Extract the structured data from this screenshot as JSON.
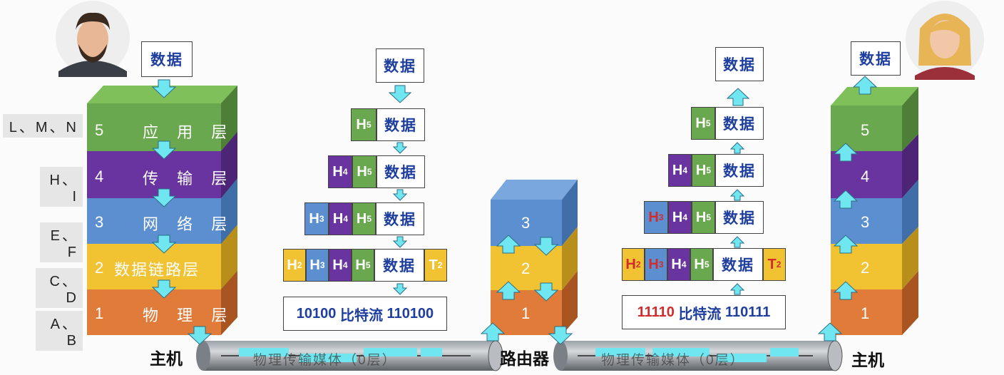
{
  "left_stack": {
    "layers": [
      {
        "num": "5",
        "name": "应 用 层",
        "side": "L、M、N"
      },
      {
        "num": "4",
        "name": "传 输 层",
        "side": "H、I"
      },
      {
        "num": "3",
        "name": "网 络 层",
        "side": "E、F"
      },
      {
        "num": "2",
        "name": "数据链路层",
        "side": "C、D"
      },
      {
        "num": "1",
        "name": "物 理 层",
        "side": "A、B"
      }
    ],
    "top_box": "数据"
  },
  "encap": {
    "data_label": "数据",
    "h5": "H",
    "h4": "H",
    "h3": "H",
    "h2": "H",
    "t2": "T",
    "s5": "5",
    "s4": "4",
    "s3": "3",
    "s2": "2",
    "bits_left": "10100",
    "bits_mid": "比特流",
    "bits_right": "110100"
  },
  "decap": {
    "data_label": "数据",
    "bits_left": "11110",
    "bits_mid": "比特流",
    "bits_right": "110111"
  },
  "router": {
    "layers": [
      "3",
      "2",
      "1"
    ],
    "label": "路由器"
  },
  "right_stack": {
    "layers": [
      "5",
      "4",
      "3",
      "2",
      "1"
    ],
    "top_box": "数据"
  },
  "hosts": {
    "left": "主机",
    "right": "主机"
  },
  "media": {
    "left": "物理传输媒体（0层）",
    "right": "物理传输媒体（0层）"
  },
  "colors": {
    "l5": "#6aa84f",
    "l4": "#6a34a0",
    "l3": "#5b8fd0",
    "l2": "#f1c232",
    "l1": "#e07b39",
    "arrow": "#6fe6f0"
  }
}
